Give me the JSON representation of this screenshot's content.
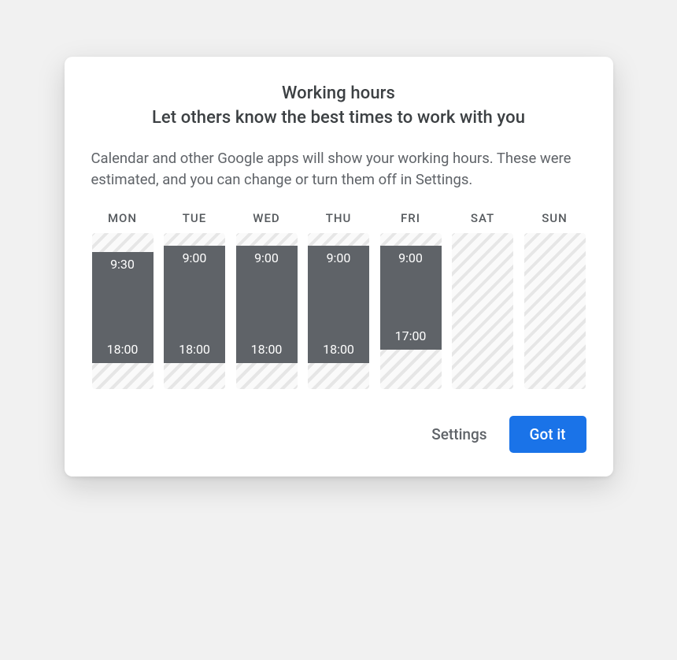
{
  "dialog": {
    "title": "Working hours",
    "subtitle": "Let others know the best times to work with you",
    "description": "Calendar and other Google apps will show your working hours. These were estimated, and you can change or turn them off in Settings."
  },
  "schedule": {
    "range_start_hour": 8.0,
    "range_end_hour": 20.0,
    "days": [
      {
        "label": "MON",
        "start_label": "9:30",
        "end_label": "18:00",
        "start_hour": 9.5,
        "end_hour": 18.0
      },
      {
        "label": "TUE",
        "start_label": "9:00",
        "end_label": "18:00",
        "start_hour": 9.0,
        "end_hour": 18.0
      },
      {
        "label": "WED",
        "start_label": "9:00",
        "end_label": "18:00",
        "start_hour": 9.0,
        "end_hour": 18.0
      },
      {
        "label": "THU",
        "start_label": "9:00",
        "end_label": "18:00",
        "start_hour": 9.0,
        "end_hour": 18.0
      },
      {
        "label": "FRI",
        "start_label": "9:00",
        "end_label": "17:00",
        "start_hour": 9.0,
        "end_hour": 17.0
      },
      {
        "label": "SAT",
        "start_label": null,
        "end_label": null,
        "start_hour": null,
        "end_hour": null
      },
      {
        "label": "SUN",
        "start_label": null,
        "end_label": null,
        "start_hour": null,
        "end_hour": null
      }
    ]
  },
  "actions": {
    "settings_label": "Settings",
    "confirm_label": "Got it"
  }
}
